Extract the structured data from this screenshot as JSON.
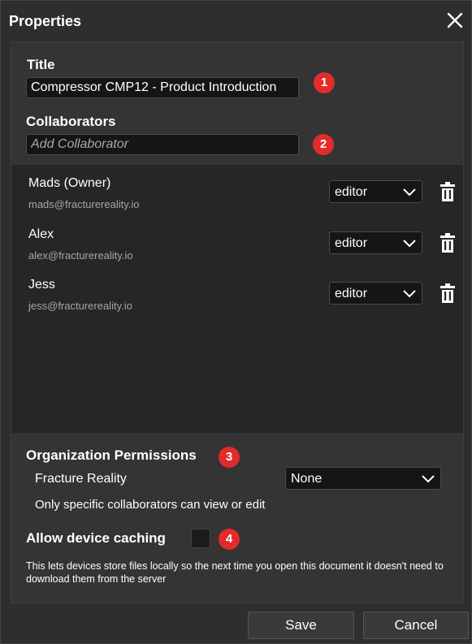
{
  "dialog": {
    "title": "Properties"
  },
  "title_section": {
    "label": "Title",
    "value": "Compressor CMP12 - Product Introduction",
    "badge": "1"
  },
  "collaborators_section": {
    "label": "Collaborators",
    "placeholder": "Add Collaborator",
    "badge": "2",
    "items": [
      {
        "name": "Mads (Owner)",
        "email": "mads@fracturereality.io",
        "role": "editor"
      },
      {
        "name": "Alex",
        "email": "alex@fracturereality.io",
        "role": "editor"
      },
      {
        "name": "Jess",
        "email": "jess@fracturereality.io",
        "role": "editor"
      }
    ]
  },
  "org_permissions": {
    "label": "Organization Permissions",
    "badge": "3",
    "org_name": "Fracture Reality",
    "selected": "None",
    "description": "Only specific collaborators can view or edit"
  },
  "device_caching": {
    "label": "Allow device caching",
    "badge": "4",
    "checked": false,
    "description": "This lets devices store files locally so the next time you open this document it doesn't need to download them from the server"
  },
  "footer": {
    "save_label": "Save",
    "cancel_label": "Cancel"
  },
  "colors": {
    "badge": "#e32b2b",
    "background": "#2e2e2e",
    "panel": "#343434",
    "list": "#262626",
    "input": "#151515"
  }
}
